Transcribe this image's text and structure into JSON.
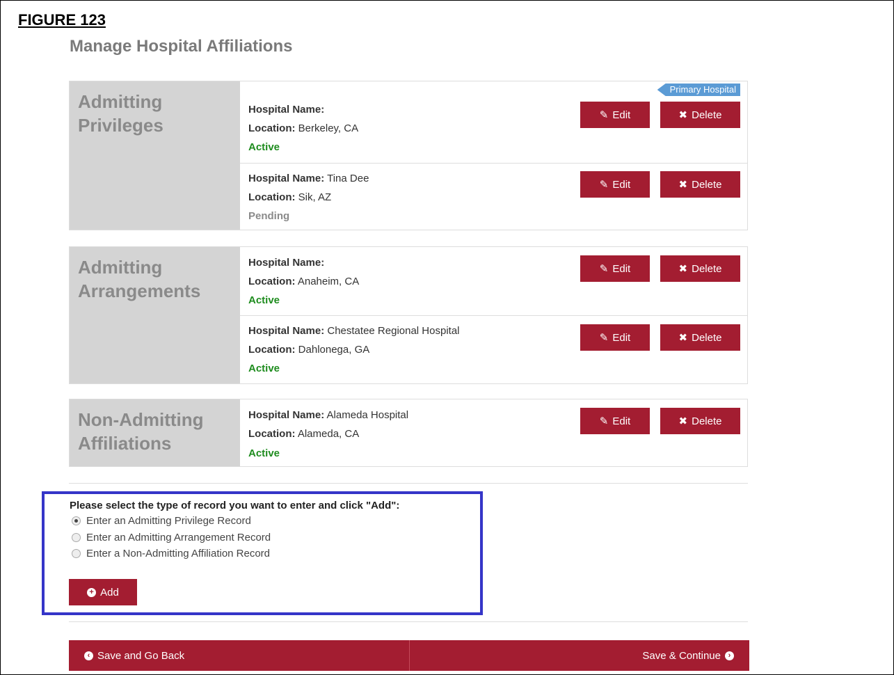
{
  "figure_label": "FIGURE 123",
  "page_title": "Manage Hospital Affiliations",
  "primary_tag": "Primary Hospital",
  "labels": {
    "hospital_name": "Hospital Name:",
    "location": "Location:"
  },
  "buttons": {
    "edit": "Edit",
    "delete": "Delete",
    "add": "Add"
  },
  "groups": [
    {
      "title": "Admitting Privileges",
      "records": [
        {
          "hospital_name": "",
          "location": "Berkeley, CA",
          "status": "Active"
        },
        {
          "hospital_name": "Tina Dee",
          "location": "Sik, AZ",
          "status": "Pending"
        }
      ]
    },
    {
      "title": "Admitting Arrangements",
      "records": [
        {
          "hospital_name": "",
          "location": "Anaheim, CA",
          "status": "Active"
        },
        {
          "hospital_name": "Chestatee Regional Hospital",
          "location": "Dahlonega, GA",
          "status": "Active"
        }
      ]
    },
    {
      "title": "Non-Admitting Affiliations",
      "records": [
        {
          "hospital_name": "Alameda Hospital",
          "location": "Alameda, CA",
          "status": "Active"
        }
      ]
    }
  ],
  "record_selector": {
    "prompt": "Please select the type of record you want to enter and click \"Add\":",
    "options": [
      {
        "label": "Enter an Admitting Privilege Record",
        "selected": true
      },
      {
        "label": "Enter an Admitting Arrangement Record",
        "selected": false
      },
      {
        "label": "Enter a Non-Admitting Affiliation Record",
        "selected": false
      }
    ]
  },
  "footer": {
    "back": "Save and Go Back",
    "continue": "Save & Continue"
  },
  "colors": {
    "accent": "#a31d31",
    "active": "#1e8c1e",
    "tag": "#5b9bd5",
    "highlight": "#3535c8"
  }
}
